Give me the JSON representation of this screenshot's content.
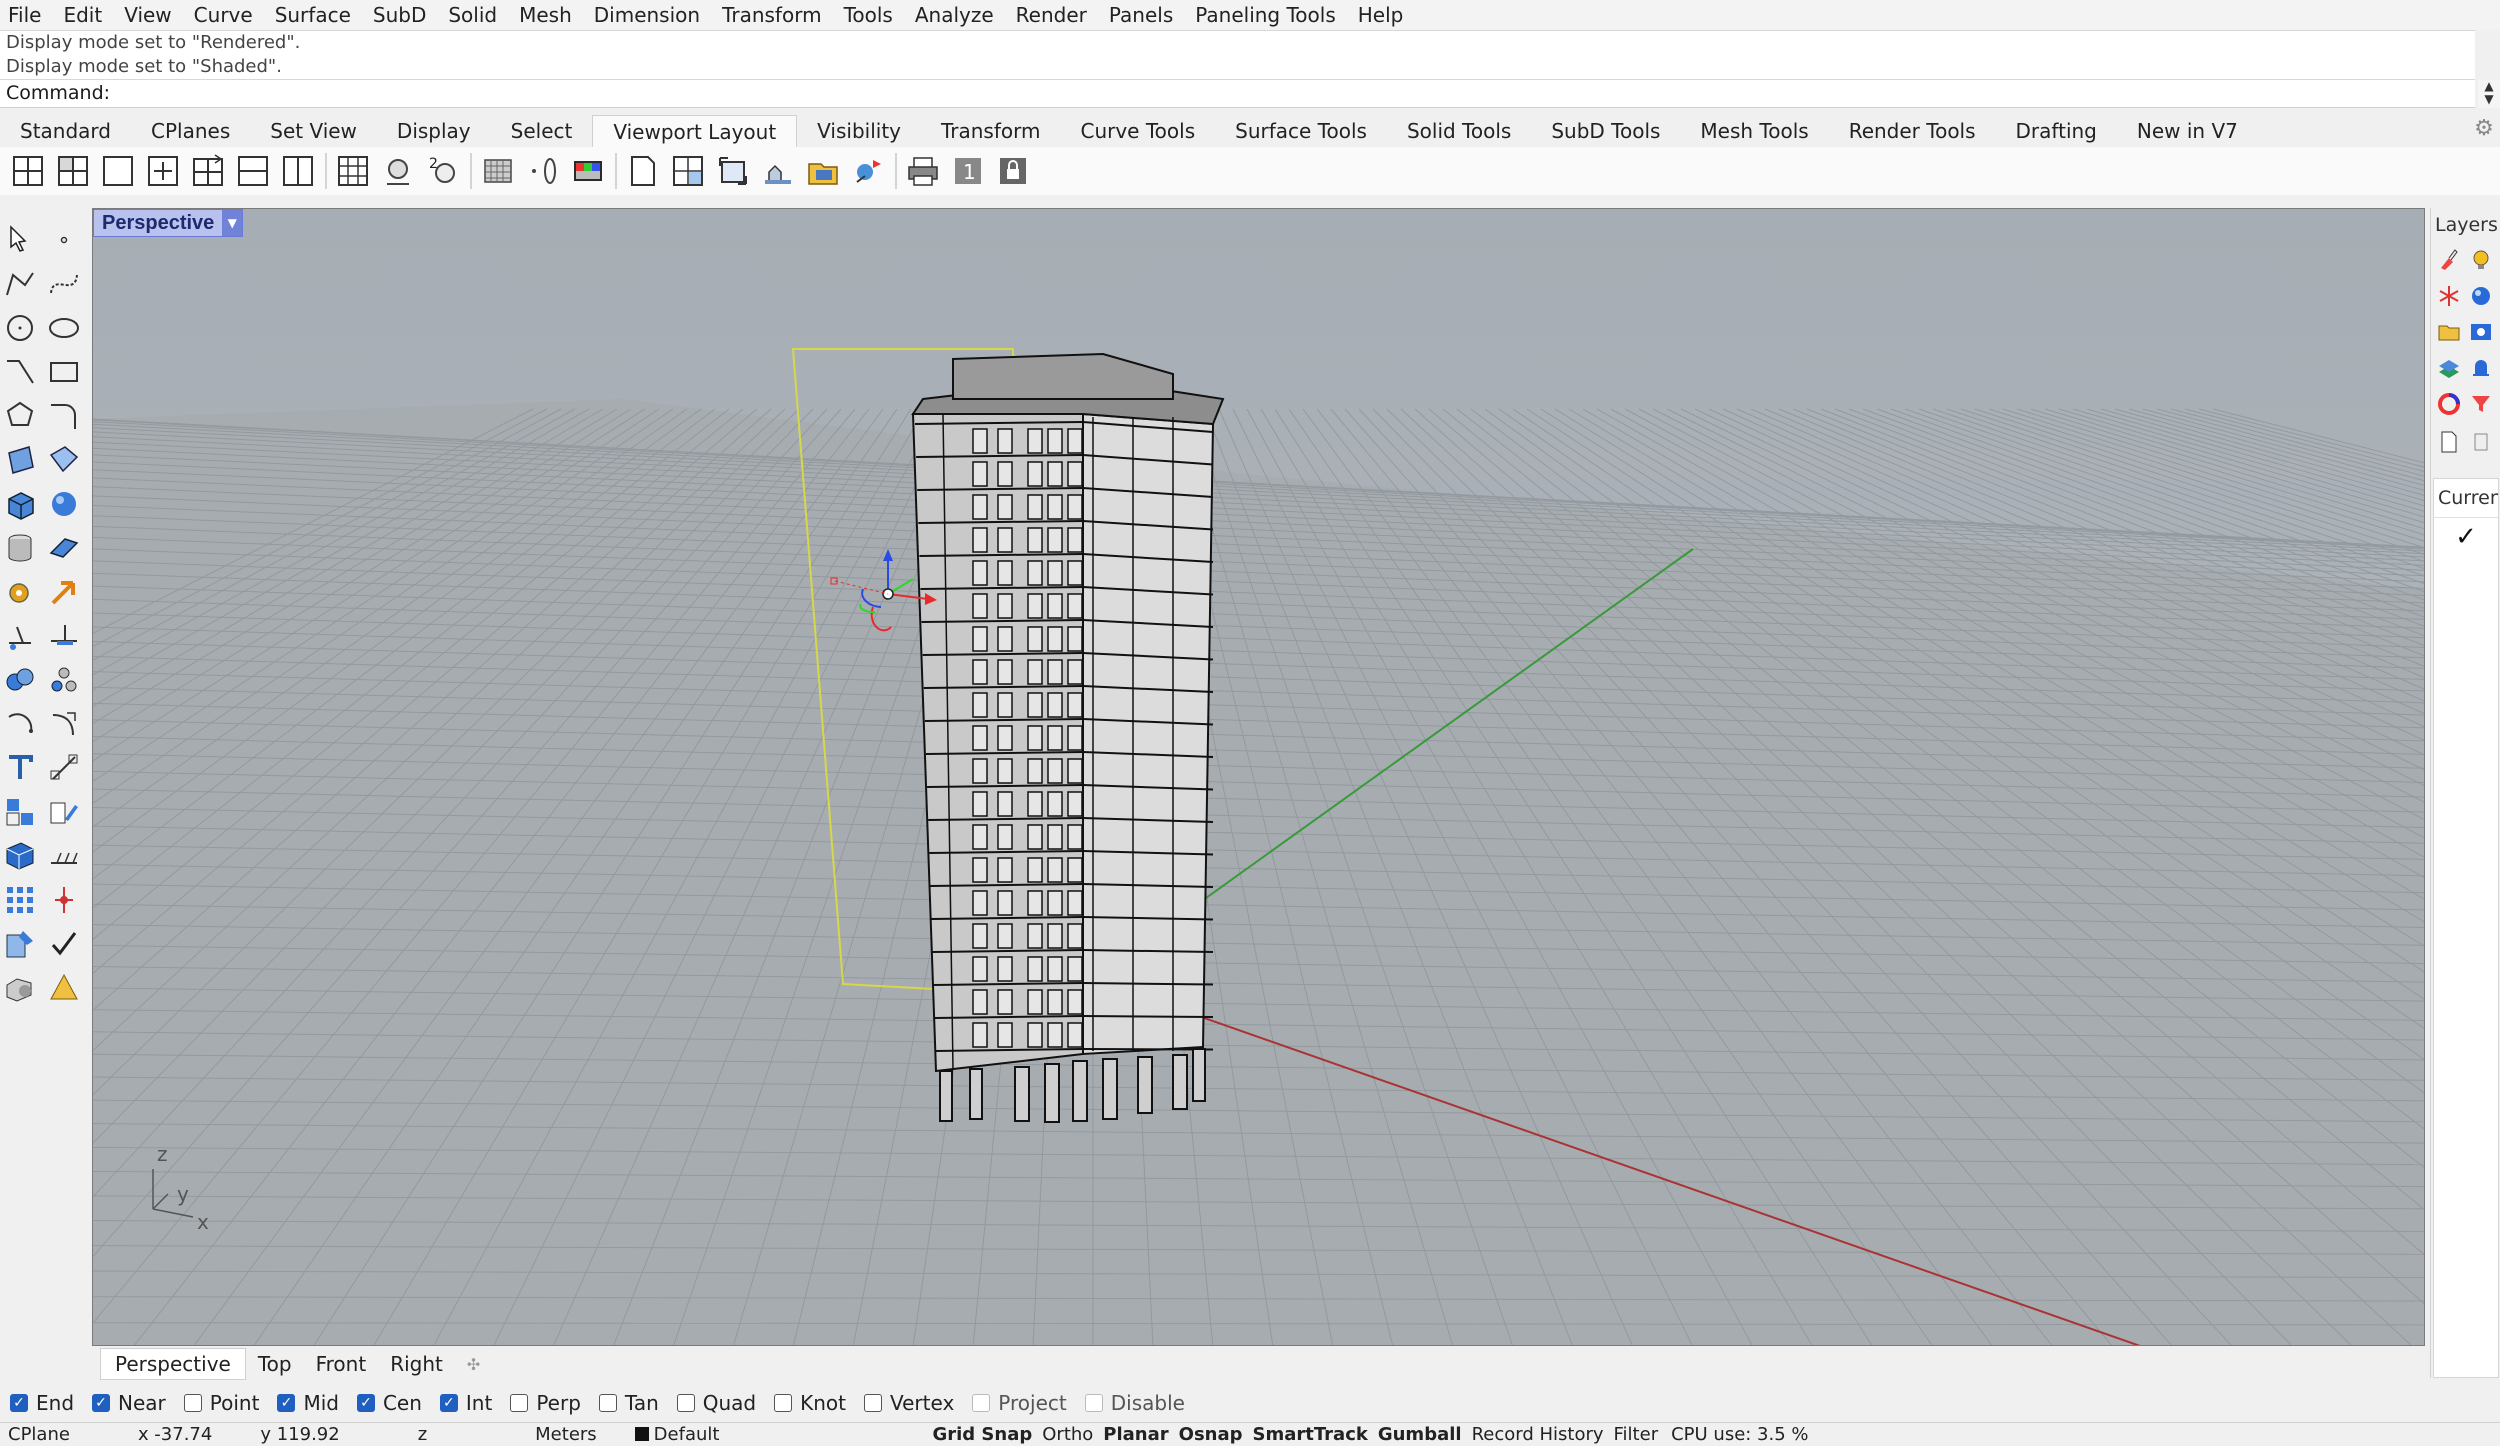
{
  "menu": [
    "File",
    "Edit",
    "View",
    "Curve",
    "Surface",
    "SubD",
    "Solid",
    "Mesh",
    "Dimension",
    "Transform",
    "Tools",
    "Analyze",
    "Render",
    "Panels",
    "Paneling Tools",
    "Help"
  ],
  "history": [
    "Display mode set to \"Rendered\".",
    "Display mode set to \"Shaded\"."
  ],
  "command_label": "Command:",
  "tabs": [
    "Standard",
    "CPlanes",
    "Set View",
    "Display",
    "Select",
    "Viewport Layout",
    "Visibility",
    "Transform",
    "Curve Tools",
    "Surface Tools",
    "Solid Tools",
    "SubD Tools",
    "Mesh Tools",
    "Render Tools",
    "Drafting",
    "New in V7"
  ],
  "active_tab": "Viewport Layout",
  "viewport": {
    "title": "Perspective",
    "axes": {
      "z": "z",
      "y": "y",
      "x": "x"
    },
    "background": "#9aa3ab",
    "grid_color": "#7f878f"
  },
  "viewport_tabs": [
    "Perspective",
    "Top",
    "Front",
    "Right"
  ],
  "right_panel": {
    "title": "Layers",
    "column_header": "Curren"
  },
  "osnap": [
    {
      "label": "End",
      "checked": true
    },
    {
      "label": "Near",
      "checked": true
    },
    {
      "label": "Point",
      "checked": false
    },
    {
      "label": "Mid",
      "checked": true
    },
    {
      "label": "Cen",
      "checked": true
    },
    {
      "label": "Int",
      "checked": true
    },
    {
      "label": "Perp",
      "checked": false
    },
    {
      "label": "Tan",
      "checked": false
    },
    {
      "label": "Quad",
      "checked": false
    },
    {
      "label": "Knot",
      "checked": false
    },
    {
      "label": "Vertex",
      "checked": false
    },
    {
      "label": "Project",
      "checked": false
    },
    {
      "label": "Disable",
      "checked": false
    }
  ],
  "status": {
    "cplane": "CPlane",
    "x": "x -37.74",
    "y": "y 119.92",
    "z": "z",
    "units": "Meters",
    "layer": "Default",
    "toggles": [
      {
        "label": "Grid Snap",
        "bold": true
      },
      {
        "label": "Ortho",
        "bold": false
      },
      {
        "label": "Planar",
        "bold": true
      },
      {
        "label": "Osnap",
        "bold": true
      },
      {
        "label": "SmartTrack",
        "bold": true
      },
      {
        "label": "Gumball",
        "bold": true
      },
      {
        "label": "Record History",
        "bold": false
      },
      {
        "label": "Filter",
        "bold": false
      }
    ],
    "cpu": "CPU use: 3.5 %"
  }
}
